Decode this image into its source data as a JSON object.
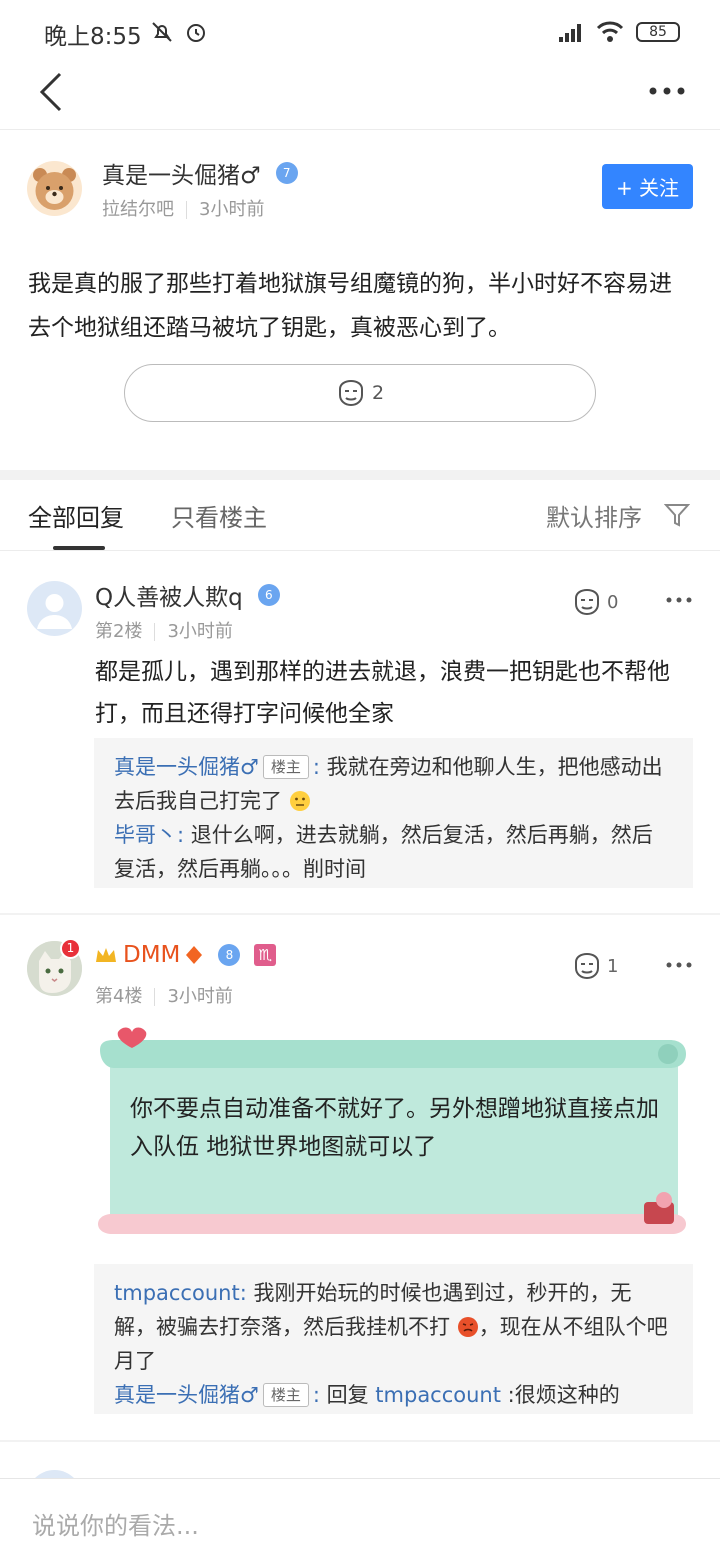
{
  "status_bar": {
    "time": "晚上8:55",
    "battery": "85"
  },
  "post": {
    "author": "真是一头倔猪♂",
    "level": "7",
    "forum": "拉结尔吧",
    "time": "3小时前",
    "follow_label": "+ 关注",
    "content": "我是真的服了那些打着地狱旗号组魔镜的狗，半小时好不容易进去个地狱组还踏马被坑了钥匙，真被恶心到了。",
    "likes": "2"
  },
  "tabs": {
    "all_replies": "全部回复",
    "only_owner": "只看楼主",
    "sort": "默认排序"
  },
  "replies": [
    {
      "name": "Q人善被人欺q",
      "level": "6",
      "floor": "第2楼",
      "time": "3小时前",
      "likes": "0",
      "content": "都是孤儿，遇到那样的进去就退，浪费一把钥匙也不帮他打，而且还得打字问候他全家",
      "subs": [
        {
          "user": "真是一头倔猪♂",
          "tag": "楼主",
          "text": "我就在旁边和他聊人生，把他感动出去后我自己打完了"
        },
        {
          "user": "毕哥丶",
          "text": "退什么啊，进去就躺，然后复活，然后再躺，然后复活，然后再躺。。。削时间"
        }
      ]
    },
    {
      "name": "DMM",
      "level": "8",
      "notify": "1",
      "floor": "第4楼",
      "time": "3小时前",
      "likes": "1",
      "card_text": "你不要点自动准备不就好了。另外想蹭地狱直接点加入队伍 地狱世界地图就可以了",
      "subs": [
        {
          "user": "tmpaccount",
          "text": "我刚开始玩的时候也遇到过，秒开的，无解，被骗去打奈落，然后我挂机不打",
          "text2": "，现在从不组队个吧月了"
        },
        {
          "user": "真是一头倔猪♂",
          "tag": "楼主",
          "reply_prefix": "回复",
          "reply_to": "tmpaccount",
          "text": ":很烦这种的"
        }
      ]
    }
  ],
  "bottom": {
    "placeholder": "说说你的看法..."
  },
  "colors": {
    "accent": "#3385ff",
    "link": "#3b6fb4",
    "vip": "#e8521d"
  }
}
